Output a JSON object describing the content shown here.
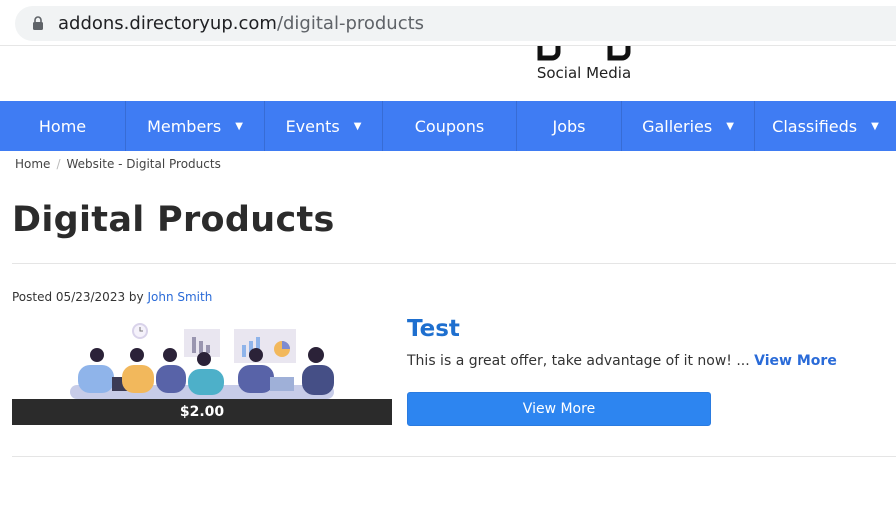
{
  "browser": {
    "url_host": "addons.directoryup.com",
    "url_path": "/digital-products"
  },
  "logo": {
    "tagline": "Social Media"
  },
  "nav": {
    "items": [
      {
        "label": "Home",
        "dropdown": false
      },
      {
        "label": "Members",
        "dropdown": true
      },
      {
        "label": "Events",
        "dropdown": true
      },
      {
        "label": "Coupons",
        "dropdown": false
      },
      {
        "label": "Jobs",
        "dropdown": false
      },
      {
        "label": "Galleries",
        "dropdown": true
      },
      {
        "label": "Classifieds",
        "dropdown": true
      }
    ],
    "caret": "▼"
  },
  "breadcrumb": {
    "home": "Home",
    "separator": "/",
    "current": "Website - Digital Products"
  },
  "page": {
    "title": "Digital Products"
  },
  "post": {
    "posted_prefix": "Posted 05/23/2023 by",
    "author": "John Smith",
    "price": "$2.00",
    "title": "Test",
    "excerpt": "This is a great offer, take advantage of it now! ...",
    "excerpt_link": "View More",
    "button_label": "View More"
  },
  "colors": {
    "nav_bg": "#3f7cf3",
    "link": "#2a6bd8",
    "button_bg": "#2d85f0",
    "price_bar": "#2b2b2b"
  }
}
